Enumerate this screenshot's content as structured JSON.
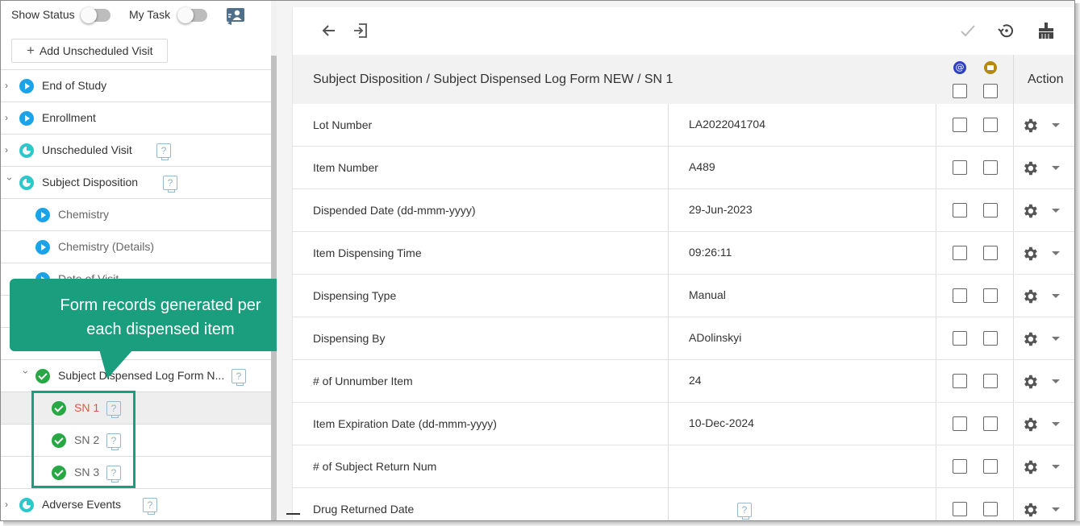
{
  "sidebar": {
    "show_status_label": "Show Status",
    "my_task_label": "My Task",
    "add_visit_label": "Add Unscheduled Visit",
    "items": [
      {
        "label": "End of Study"
      },
      {
        "label": "Enrollment"
      },
      {
        "label": "Unscheduled Visit"
      },
      {
        "label": "Subject Disposition"
      },
      {
        "label": "Chemistry"
      },
      {
        "label": "Chemistry (Details)"
      },
      {
        "label": "Date of Visit"
      },
      {
        "label": ""
      },
      {
        "label": ""
      },
      {
        "label": "Subject Dispensed Log Form N..."
      },
      {
        "label": "SN 1"
      },
      {
        "label": "SN 2"
      },
      {
        "label": "SN 3"
      },
      {
        "label": "Adverse Events"
      }
    ],
    "help_glyph": "?"
  },
  "callout": {
    "line1": "Form records generated per",
    "line2": "each dispensed item",
    "color": "#1a9e7d"
  },
  "form": {
    "breadcrumb": "Subject Disposition / Subject Dispensed Log Form NEW / SN 1",
    "action_header": "Action",
    "rows": [
      {
        "label": "Lot Number",
        "value": "LA2022041704"
      },
      {
        "label": "Item Number",
        "value": "A489"
      },
      {
        "label": "Dispended Date (dd-mmm-yyyy)",
        "value": "29-Jun-2023"
      },
      {
        "label": "Item Dispensing Time",
        "value": "09:26:11"
      },
      {
        "label": "Dispensing Type",
        "value": "Manual"
      },
      {
        "label": "Dispensing By",
        "value": "ADolinskyi"
      },
      {
        "label": "# of Unnumber Item",
        "value": "24"
      },
      {
        "label": "Item Expiration Date (dd-mmm-yyyy)",
        "value": "10-Dec-2024"
      },
      {
        "label": "# of Subject Return Num",
        "value": ""
      },
      {
        "label": "Drug Returned Date",
        "value": ""
      }
    ]
  },
  "toolbar": {
    "back_icon": "arrow-left-icon",
    "exit_icon": "sign-in-icon",
    "check_icon": "check-icon",
    "history_icon": "history-icon",
    "clear_icon": "broom-icon"
  },
  "colors": {
    "selected_sn": "#e8543a",
    "play_icon": "#1aa3e8",
    "check_icon": "#27a844",
    "query_icon": "#2f3fc6",
    "file_icon": "#b58a12"
  }
}
